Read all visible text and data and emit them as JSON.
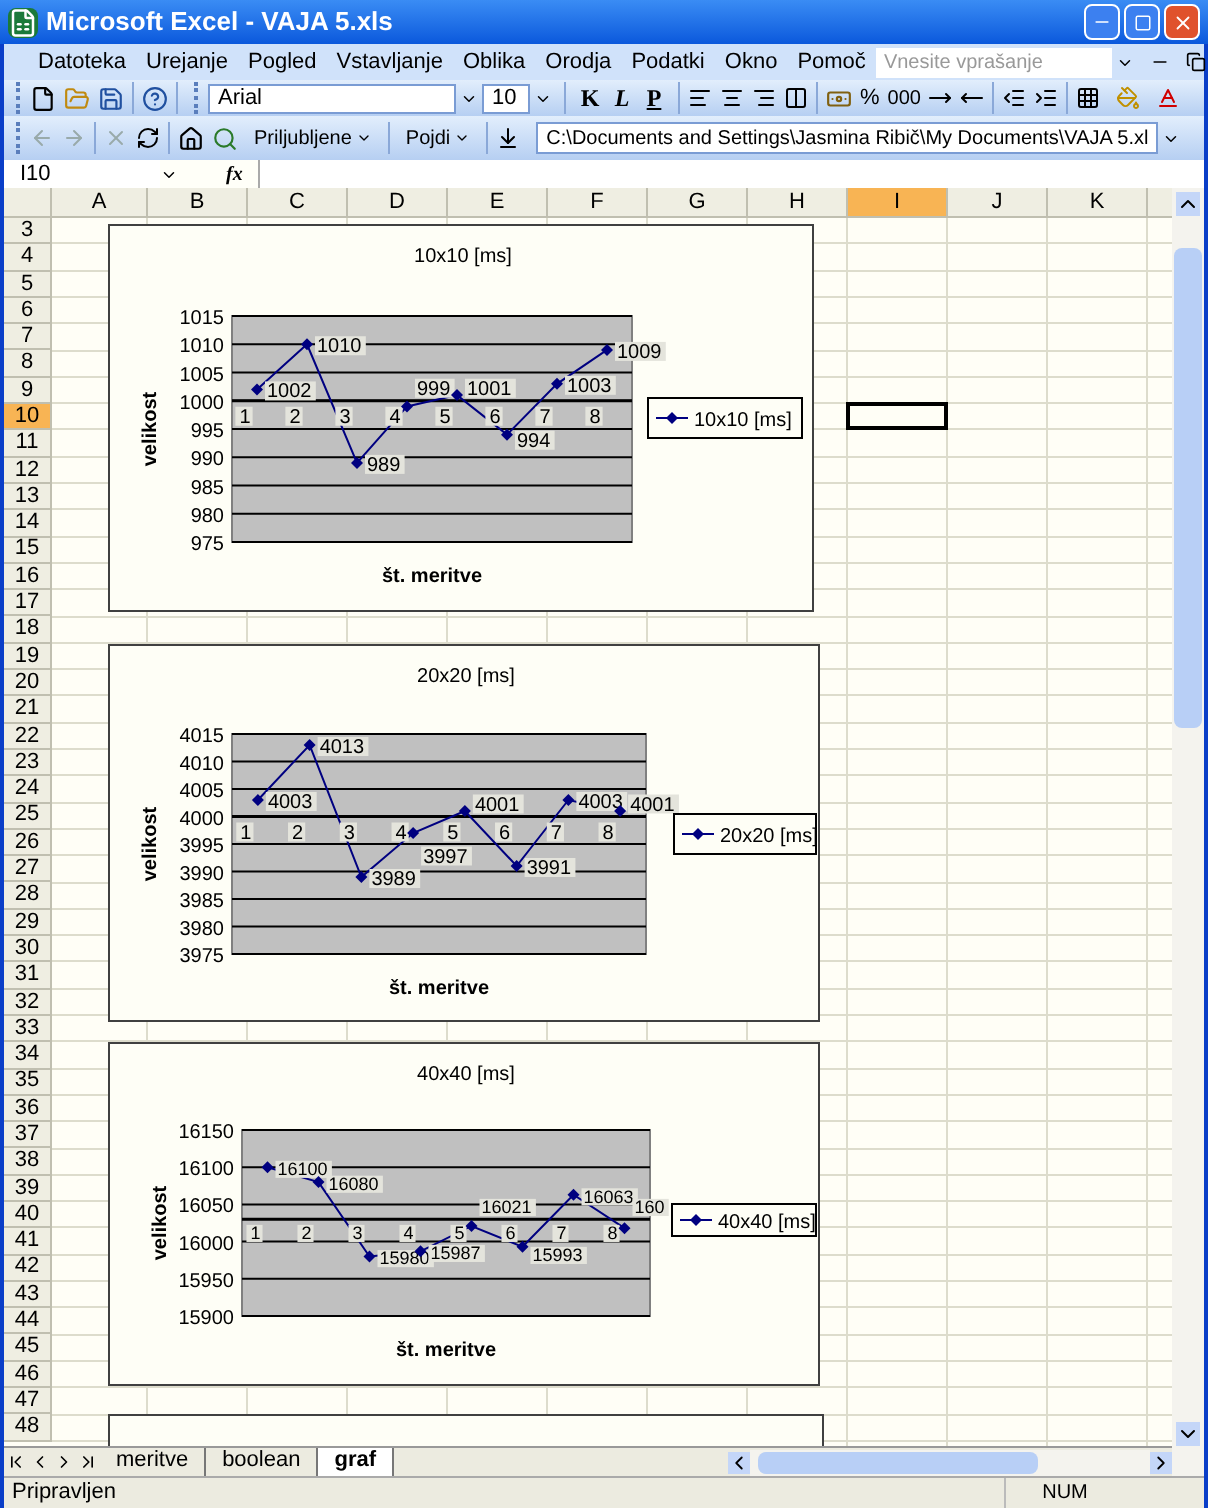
{
  "window": {
    "title": "Microsoft Excel - VAJA 5.xls"
  },
  "menu": [
    "Datoteka",
    "Urejanje",
    "Pogled",
    "Vstavljanje",
    "Oblika",
    "Orodja",
    "Podatki",
    "Okno",
    "Pomoč"
  ],
  "help_box": {
    "placeholder": "Vnesite vprašanje"
  },
  "formatting_toolbar": {
    "font": "Arial",
    "size": "10",
    "style_buttons": [
      "K",
      "L",
      "P"
    ],
    "percent": "%",
    "thousands": "000"
  },
  "web_toolbar": {
    "favorites": "Priljubljene",
    "go": "Pojdi",
    "address": "C:\\Documents and Settings\\Jasmina Ribič\\My Documents\\VAJA 5.xl"
  },
  "formula_bar": {
    "name_box": "I10",
    "function_label": "fx"
  },
  "columns": [
    {
      "label": "A",
      "selected": false
    },
    {
      "label": "B",
      "selected": false
    },
    {
      "label": "C",
      "selected": false
    },
    {
      "label": "D",
      "selected": false
    },
    {
      "label": "E",
      "selected": false
    },
    {
      "label": "F",
      "selected": false
    },
    {
      "label": "G",
      "selected": false
    },
    {
      "label": "H",
      "selected": false
    },
    {
      "label": "I",
      "selected": true
    },
    {
      "label": "J",
      "selected": false
    },
    {
      "label": "K",
      "selected": false
    }
  ],
  "rows": [
    {
      "label": "3",
      "selected": false
    },
    {
      "label": "4",
      "selected": false
    },
    {
      "label": "5",
      "selected": false
    },
    {
      "label": "6",
      "selected": false
    },
    {
      "label": "7",
      "selected": false
    },
    {
      "label": "8",
      "selected": false
    },
    {
      "label": "9",
      "selected": false
    },
    {
      "label": "10",
      "selected": true
    },
    {
      "label": "11",
      "selected": false
    },
    {
      "label": "12",
      "selected": false
    },
    {
      "label": "13",
      "selected": false
    },
    {
      "label": "14",
      "selected": false
    },
    {
      "label": "15",
      "selected": false
    },
    {
      "label": "16",
      "selected": false
    },
    {
      "label": "17",
      "selected": false
    },
    {
      "label": "18",
      "selected": false
    },
    {
      "label": "19",
      "selected": false
    },
    {
      "label": "20",
      "selected": false
    },
    {
      "label": "21",
      "selected": false
    },
    {
      "label": "22",
      "selected": false
    },
    {
      "label": "23",
      "selected": false
    },
    {
      "label": "24",
      "selected": false
    },
    {
      "label": "25",
      "selected": false
    },
    {
      "label": "26",
      "selected": false
    },
    {
      "label": "27",
      "selected": false
    },
    {
      "label": "28",
      "selected": false
    },
    {
      "label": "29",
      "selected": false
    },
    {
      "label": "30",
      "selected": false
    },
    {
      "label": "31",
      "selected": false
    },
    {
      "label": "32",
      "selected": false
    },
    {
      "label": "33",
      "selected": false
    },
    {
      "label": "34",
      "selected": false
    },
    {
      "label": "35",
      "selected": false
    },
    {
      "label": "36",
      "selected": false
    },
    {
      "label": "37",
      "selected": false
    },
    {
      "label": "38",
      "selected": false
    },
    {
      "label": "39",
      "selected": false
    },
    {
      "label": "40",
      "selected": false
    },
    {
      "label": "41",
      "selected": false
    },
    {
      "label": "42",
      "selected": false
    },
    {
      "label": "43",
      "selected": false
    },
    {
      "label": "44",
      "selected": false
    },
    {
      "label": "45",
      "selected": false
    },
    {
      "label": "46",
      "selected": false
    },
    {
      "label": "47",
      "selected": false
    },
    {
      "label": "48",
      "selected": false
    }
  ],
  "charts": [
    {
      "chart_data": {
        "type": "line",
        "title": "10x10 [ms]",
        "xlabel": "št. meritve",
        "ylabel": "velikost",
        "categories": [
          "1",
          "2",
          "3",
          "4",
          "5",
          "6",
          "7",
          "8"
        ],
        "series": [
          {
            "name": "10x10 [ms]",
            "color": "#000080",
            "marker": "diamond",
            "values": [
              1002,
              1010,
              989,
              999,
              1001,
              994,
              1003,
              1009
            ]
          }
        ],
        "ylim": [
          975,
          1015
        ],
        "yticks": [
          975,
          980,
          985,
          990,
          995,
          1000,
          1005,
          1010,
          1015
        ],
        "grid": true,
        "value_labels": [
          "1002",
          "1010",
          "989",
          "999",
          "1001",
          "994",
          "1003",
          "1009"
        ]
      }
    },
    {
      "chart_data": {
        "type": "line",
        "title": "20x20 [ms]",
        "xlabel": "št. meritve",
        "ylabel": "velikost",
        "categories": [
          "1",
          "2",
          "3",
          "4",
          "5",
          "6",
          "7",
          "8"
        ],
        "series": [
          {
            "name": "20x20 [ms]",
            "color": "#000080",
            "marker": "diamond",
            "values": [
              4003,
              4013,
              3989,
              3997,
              4001,
              3991,
              4003,
              4001
            ]
          }
        ],
        "ylim": [
          3975,
          4015
        ],
        "yticks": [
          3975,
          3980,
          3985,
          3990,
          3995,
          4000,
          4005,
          4010,
          4015
        ],
        "grid": true,
        "value_labels": [
          "4003",
          "4013",
          "3989",
          "3997",
          "4001",
          "3991",
          "4003",
          "4001"
        ]
      }
    },
    {
      "chart_data": {
        "type": "line",
        "title": "40x40 [ms]",
        "xlabel": "št. meritve",
        "ylabel": "velikost",
        "categories": [
          "1",
          "2",
          "3",
          "4",
          "5",
          "6",
          "7",
          "8"
        ],
        "series": [
          {
            "name": "40x40 [ms]",
            "color": "#000080",
            "marker": "diamond",
            "values": [
              16100,
              16080,
              15980,
              15987,
              16021,
              15993,
              16063,
              16018
            ]
          }
        ],
        "ylim": [
          15900,
          16150
        ],
        "yticks": [
          15900,
          15950,
          16000,
          16050,
          16100,
          16150
        ],
        "grid": true,
        "value_labels": [
          "16100",
          "16080",
          "15980",
          "15987",
          "16021",
          "15993",
          "16063",
          "160"
        ]
      }
    }
  ],
  "sheet_tabs": [
    {
      "label": "meritve",
      "selected": false
    },
    {
      "label": "boolean",
      "selected": false
    },
    {
      "label": "graf",
      "selected": true
    }
  ],
  "status_bar": {
    "text": "Pripravljen",
    "indicators": [
      "NUM"
    ]
  }
}
